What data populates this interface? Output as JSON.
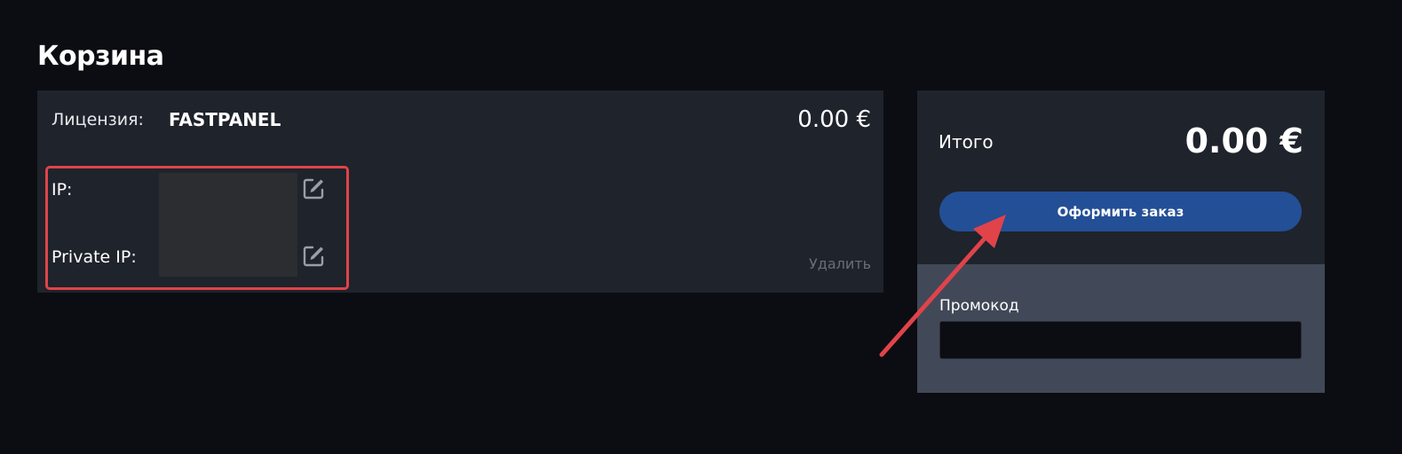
{
  "page": {
    "title": "Корзина"
  },
  "cart_item": {
    "license_label": "Лицензия:",
    "license_name": "FASTPANEL",
    "price": "0.00 €",
    "ip_label": "IP:",
    "private_ip_label": "Private IP:",
    "delete_label": "Удалить",
    "edit_icon": "edit-pencil-square-icon"
  },
  "summary": {
    "total_label": "Итого",
    "total_value": "0.00 €",
    "checkout_label": "Оформить заказ",
    "promo_label": "Промокод",
    "promo_value": ""
  },
  "colors": {
    "background": "#0c0d12",
    "panel": "#1f232b",
    "promo_panel": "#414958",
    "button": "#234f96",
    "highlight": "#e0434a"
  }
}
